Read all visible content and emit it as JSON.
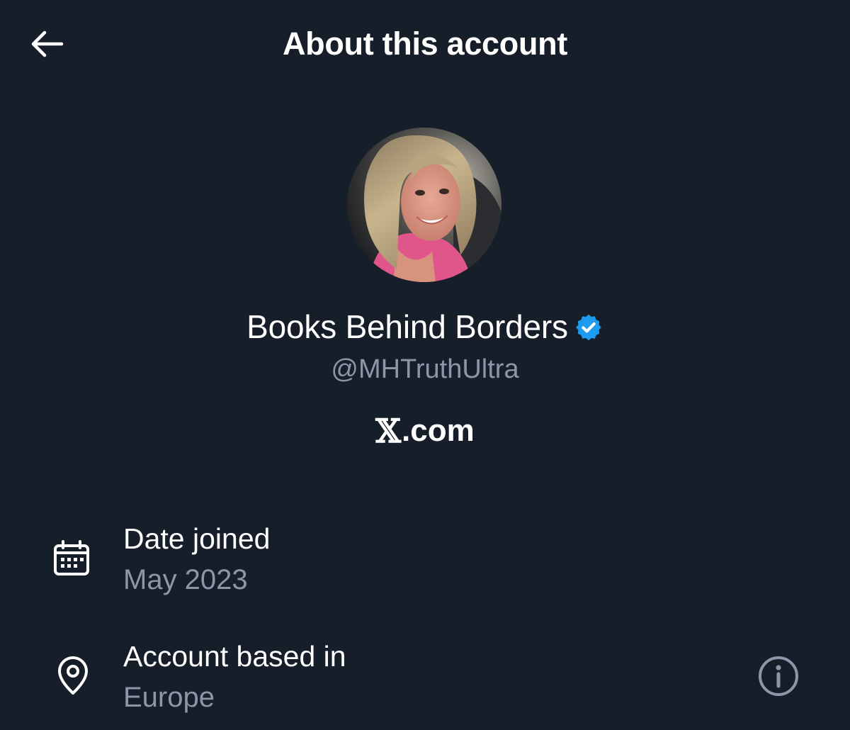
{
  "header": {
    "title": "About this account",
    "back_icon": "arrow-left-icon"
  },
  "profile": {
    "display_name": "Books Behind Borders",
    "verified": true,
    "verified_icon": "verified-badge-icon",
    "handle": "@MHTruthUltra",
    "avatar_icon": "profile-photo"
  },
  "platform": {
    "mark": "𝕏",
    "suffix": ".com"
  },
  "details": {
    "date_joined": {
      "icon": "calendar-icon",
      "label": "Date joined",
      "value": "May 2023"
    },
    "account_location": {
      "icon": "location-pin-icon",
      "label": "Account based in",
      "value": "Europe",
      "info_icon": "info-icon"
    }
  },
  "colors": {
    "background": "#161e2a",
    "text_primary": "#ffffff",
    "text_secondary": "#8b97a8",
    "verified_blue": "#1d9bf0"
  }
}
